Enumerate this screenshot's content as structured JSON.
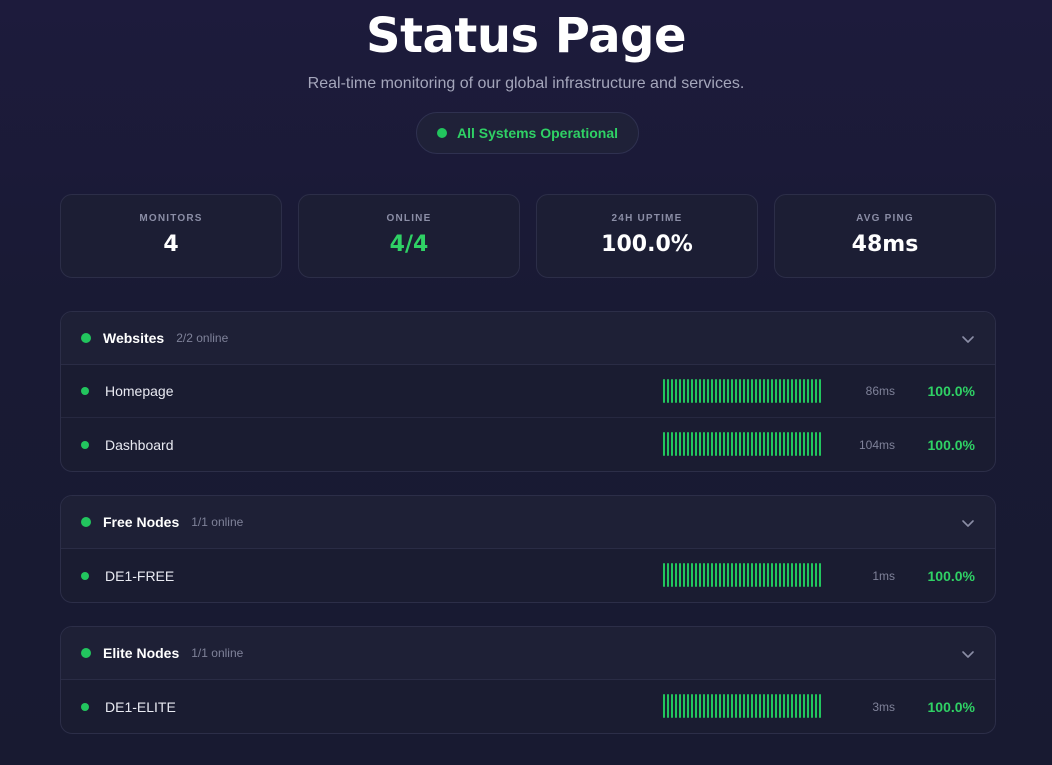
{
  "header": {
    "title": "Status Page",
    "subtitle": "Real-time monitoring of our global infrastructure and services.",
    "status": "All Systems Operational"
  },
  "stats": [
    {
      "label": "MONITORS",
      "value": "4"
    },
    {
      "label": "ONLINE",
      "value": "4/4"
    },
    {
      "label": "24H UPTIME",
      "value": "100.0%"
    },
    {
      "label": "AVG PING",
      "value": "48ms"
    }
  ],
  "groups": [
    {
      "name": "Websites",
      "count": "2/2 online",
      "monitors": [
        {
          "name": "Homepage",
          "ping": "86ms",
          "uptime": "100.0%"
        },
        {
          "name": "Dashboard",
          "ping": "104ms",
          "uptime": "100.0%"
        }
      ]
    },
    {
      "name": "Free Nodes",
      "count": "1/1 online",
      "monitors": [
        {
          "name": "DE1-FREE",
          "ping": "1ms",
          "uptime": "100.0%"
        }
      ]
    },
    {
      "name": "Elite Nodes",
      "count": "1/1 online",
      "monitors": [
        {
          "name": "DE1-ELITE",
          "ping": "3ms",
          "uptime": "100.0%"
        }
      ]
    }
  ],
  "colors": {
    "accent": "#22c55e",
    "background": "#191b33"
  },
  "icons": {
    "status": "dot-icon",
    "collapse": "chevron-down-icon"
  }
}
